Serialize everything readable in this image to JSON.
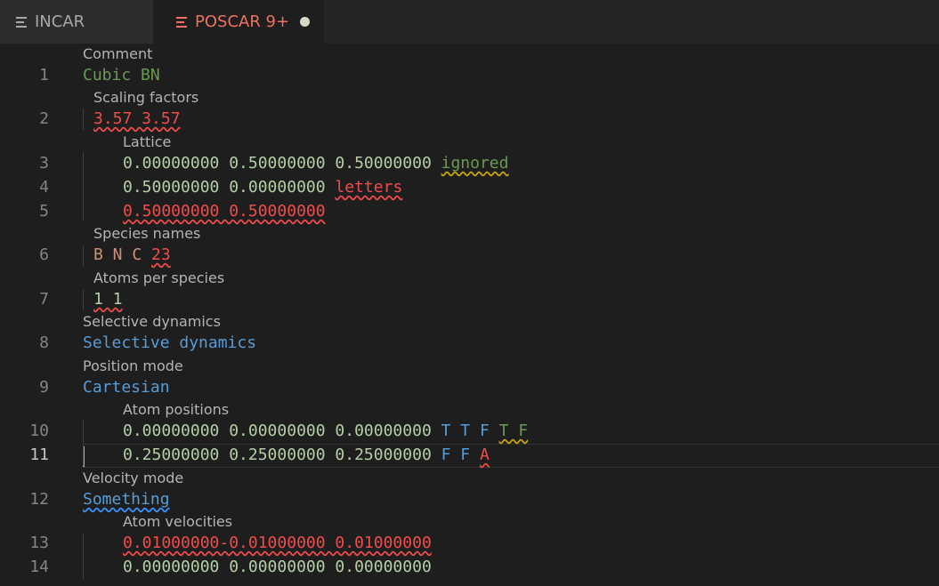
{
  "tabs": [
    {
      "label": "INCAR",
      "active": false
    },
    {
      "label": "POSCAR 9+",
      "active": true,
      "dirty": true
    }
  ],
  "colors": {
    "comment_green": "#6a9955",
    "number": "#b5cea8",
    "error_red": "#f14c4c",
    "keyword_blue": "#569cd6",
    "species_orange": "#ce9178",
    "active_tab_text": "#f0715f"
  },
  "line_numbers": [
    "1",
    "2",
    "3",
    "4",
    "5",
    "6",
    "7",
    "8",
    "9",
    "10",
    "11",
    "12",
    "13",
    "14"
  ],
  "hints": {
    "comment": "Comment",
    "scaling": "Scaling factors",
    "lattice": "Lattice",
    "species": "Species names",
    "atoms_per_species": "Atoms per species",
    "selective": "Selective dynamics",
    "position_mode": "Position mode",
    "atom_positions": "Atom positions",
    "velocity_mode": "Velocity mode",
    "atom_velocities": "Atom velocities"
  },
  "code": {
    "l1": "Cubic BN",
    "l2": "3.57 3.57",
    "l3_nums": "0.00000000 0.50000000 0.50000000",
    "l3_extra": "ignored",
    "l4_nums": "0.50000000 0.00000000",
    "l4_extra": "letters",
    "l5": "0.50000000 0.50000000",
    "l6_species": "B N C",
    "l6_extra": "23",
    "l7": "1 1",
    "l8": "Selective dynamics",
    "l9": "Cartesian",
    "l10_nums": "0.00000000 0.00000000 0.00000000",
    "l10_flags": "T T F",
    "l10_extra": "T F",
    "l11_nums": "0.25000000 0.25000000 0.25000000",
    "l11_flags": "F F",
    "l11_extra": "A",
    "l12": "Something",
    "l13": "0.01000000-0.01000000 0.01000000",
    "l14": "0.00000000 0.00000000 0.00000000"
  }
}
